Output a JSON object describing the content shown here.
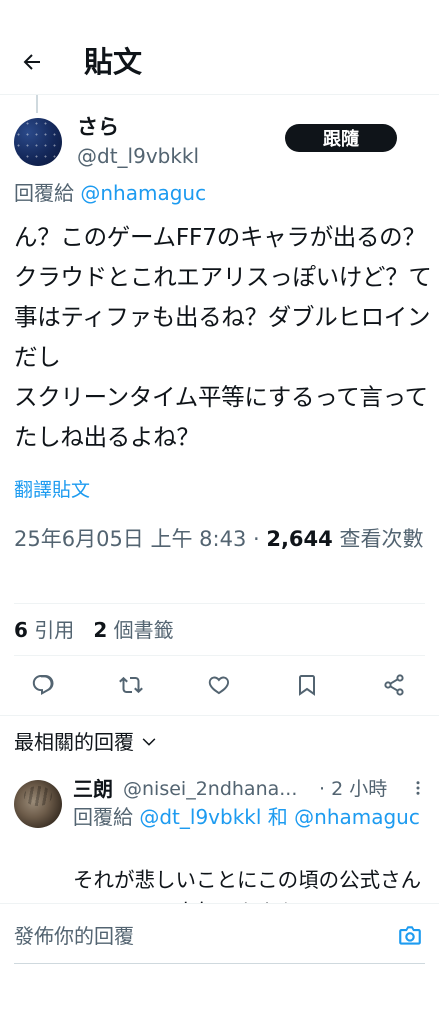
{
  "header": {
    "title": "貼文",
    "back_icon": "arrow-left-icon"
  },
  "author": {
    "display_name": "さら",
    "username": "@dt_l9vbkkl",
    "follow_label": "跟隨"
  },
  "reply_to": {
    "prefix": "回覆給 ",
    "handle": "@nhamaguc"
  },
  "tweet": {
    "text": "ん？このゲームFF7のキャラが出るの？クラウドとこれエアリスっぽいけど？て事はティファも出るね？ダブルヒロインだし\nスクリーンタイム平等にするって言ってたしね出るよね？"
  },
  "translate_label": "翻譯貼文",
  "meta": {
    "timestamp": "25年6月05日 上午 8:43 · ",
    "views": "2,644",
    "views_label": " 查看次數"
  },
  "stats": {
    "quotes_count": "6",
    "quotes_label": " 引用",
    "bookmarks_count": "2",
    "bookmarks_label": " 個書籤"
  },
  "actions": [
    "reply-icon",
    "retweet-icon",
    "like-icon",
    "bookmark-icon",
    "share-icon"
  ],
  "sort": {
    "label": "最相關的回覆",
    "icon": "chevron-down-icon"
  },
  "reply": {
    "name": "三朗",
    "handle": "@nisei_2ndhana...",
    "time": "· 2 小時",
    "replyto_prefix": "回覆給 ",
    "replyto_handles": "@dt_l9vbkkl 和 @nhamaguc",
    "text": "それが悲しいことにこの頃の公式さんはエアリス人気にあやかって"
  },
  "composer": {
    "placeholder": "發佈你的回覆",
    "camera_icon": "camera-icon"
  },
  "colors": {
    "link": "#1d9bf0",
    "text": "#0f1419",
    "muted": "#536471"
  }
}
